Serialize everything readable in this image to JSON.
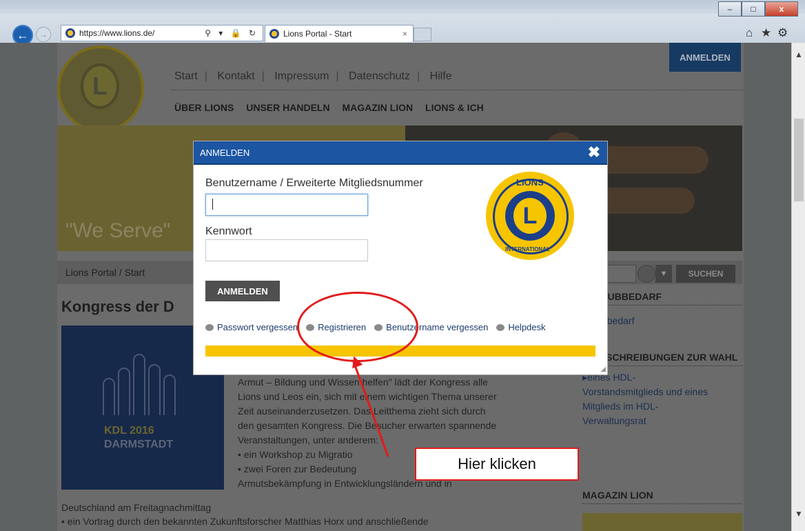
{
  "browser": {
    "url": "https://www.lions.de/",
    "tab_title": "Lions Portal - Start",
    "tab_close": "×",
    "window_minimize": "–",
    "window_maximize": "□",
    "window_close": "x",
    "back_glyph": "←",
    "forward_glyph": "→",
    "address_controls": "⚲ ▾ 🔒 ↻",
    "home_glyph": "⌂",
    "favorites_glyph": "★",
    "settings_glyph": "⚙"
  },
  "site": {
    "login_top": "ANMELDEN",
    "top_nav": [
      "Start",
      "Kontakt",
      "Impressum",
      "Datenschutz",
      "Hilfe"
    ],
    "top_nav_sep": "|",
    "main_nav": [
      "ÜBER LIONS",
      "UNSER HANDELN",
      "MAGAZIN LION",
      "LIONS & ICH"
    ],
    "banner_text": "\"We Serve\"",
    "breadcrumb": "Lions Portal / Start",
    "search_button": "SUCHEN",
    "search_dropdown": "▼",
    "page_title": "Kongress der D",
    "kdl_line1": "KDL 2016",
    "kdl_line2": "DARMSTADT",
    "article_lines": [
      "Armut – Bildung und Wissen helfen\" lädt der Kongress alle",
      "Lions und Leos ein, sich mit einem wichtigen Thema unserer",
      "Zeit auseinanderzusetzen. Das Leitthema zieht sich durch",
      "den gesamten Kongress. Die Besucher erwarten spannende",
      "Veranstaltungen, unter anderem:"
    ],
    "article_bullets": [
      "•  ein Workshop zu Migratio",
      "•  zwei Foren zur Bedeutung"
    ],
    "article_tail": "Armutsbekämpfung in Entwicklungsländern und in",
    "cont1": "Deutschland am Freitagnachmittag",
    "cont2": "•  ein Vortrag durch den bekannten Zukunftsforscher Matthias Horx und anschließende",
    "sidebar": {
      "head1": "IS-CLUBBEDARF",
      "link1": "bbedarf",
      "head2": "SCHREIBUNGEN ZUR WAHL",
      "link2_lines": [
        "▸eines HDL-",
        "Vorstandsmitglieds und eines",
        "Mitglieds im HDL-",
        "Verwaltungsrat"
      ],
      "magazin": "MAGAZIN LION"
    }
  },
  "modal": {
    "title": "ANMELDEN",
    "close": "✖",
    "username_label": "Benutzername / Erweiterte Mitgliedsnummer",
    "username_value": "",
    "password_label": "Kennwort",
    "password_value": "",
    "submit": "ANMELDEN",
    "links": [
      "Passwort vergessen",
      "Registrieren",
      "Benutzername vergessen",
      "Helpdesk"
    ],
    "logo_top": "LIONS",
    "logo_letter": "L",
    "logo_bottom": "INTERNATIONAL"
  },
  "annotation": {
    "callout": "Hier klicken",
    "color": "#e21b1b"
  },
  "colors": {
    "modal_header": "#1c56a2",
    "lions_yellow": "#f6c500",
    "lions_blue": "#1c3f8a"
  }
}
